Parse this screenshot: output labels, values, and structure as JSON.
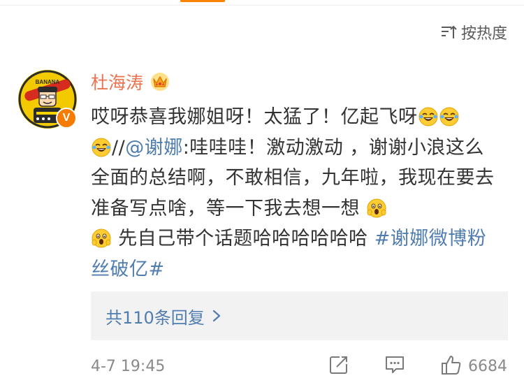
{
  "header": {
    "sort_label": "按热度"
  },
  "comment": {
    "username": "杜海涛",
    "crown_icon": "crown-icon",
    "badge": "V",
    "text_part1": "哎呀恭喜我娜姐呀！太猛了！亿起飞呀",
    "text_part2": "//",
    "mention": "@谢娜",
    "text_part3": ":哇哇哇！激动激动 ，谢谢小浪这么全面的总结啊，不敢相信，九年啦，我现在要去准备写点啥，等一下我去想一想",
    "text_part4": "先自己带个话题哈哈哈哈哈哈",
    "hashtag": "#谢娜微博粉丝破亿#",
    "emojis": [
      "laugh-cry-emoji",
      "laugh-cry-emoji",
      "laugh-cry-emoji",
      "scream-emoji",
      "scream-emoji"
    ],
    "replies_label": "共110条回复",
    "timestamp": "4-7 19:45",
    "like_count": "6684"
  },
  "colors": {
    "username": "#eb7350",
    "link": "#507daf",
    "text": "#333333",
    "meta": "#8a8a8a",
    "reply_bg": "#f2f2f2",
    "accent": "#ff8200"
  },
  "avatar_text": "BANANA SUPERMAN",
  "icons": [
    "sort-icon",
    "crown-icon",
    "chevron-right-icon",
    "share-icon",
    "comment-icon",
    "like-icon"
  ]
}
